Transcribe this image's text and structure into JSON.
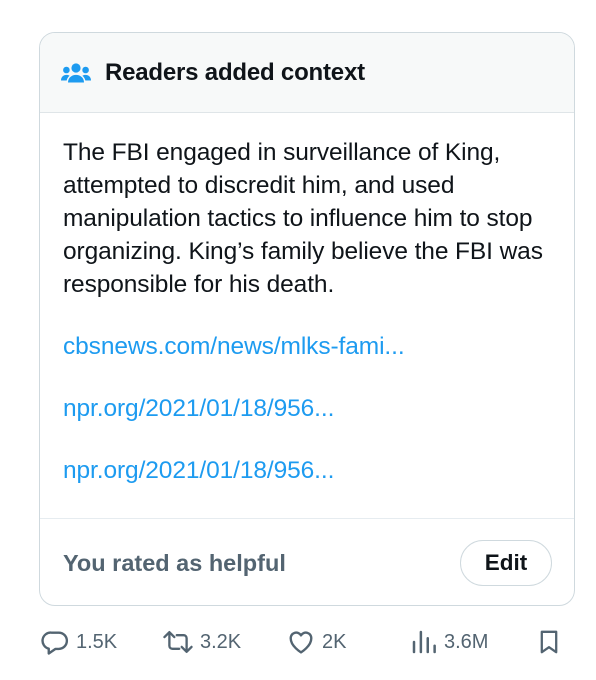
{
  "note": {
    "header_title": "Readers added context",
    "header_icon": "people-icon",
    "body_text": "The FBI engaged in surveillance of King, attempted to discredit him, and used manipulation tactics to influence him to stop organizing. King’s family believe the FBI was responsible for his death.",
    "sources": [
      "cbsnews.com/news/mlks-fami...",
      "npr.org/2021/01/18/956...",
      "npr.org/2021/01/18/956..."
    ],
    "rated_label": "You rated as helpful",
    "edit_label": "Edit"
  },
  "actions": {
    "replies": "1.5K",
    "reposts": "3.2K",
    "likes": "2K",
    "views": "3.6M",
    "icons": [
      "reply-icon",
      "repost-icon",
      "like-icon",
      "views-icon",
      "bookmark-icon"
    ]
  },
  "colors": {
    "accent": "#1d9bf0",
    "muted": "#536471",
    "text": "#0f1419",
    "header_bg": "#f7f9f9",
    "border": "#cfd9de"
  }
}
